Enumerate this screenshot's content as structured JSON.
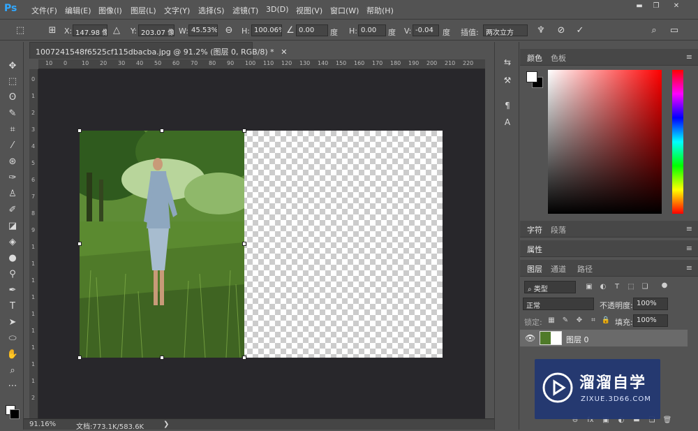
{
  "app": {
    "logo": "Ps"
  },
  "menubar": {
    "items": [
      "文件(F)",
      "编辑(E)",
      "图像(I)",
      "图层(L)",
      "文字(Y)",
      "选择(S)",
      "滤镜(T)",
      "3D(D)",
      "视图(V)",
      "窗口(W)",
      "帮助(H)"
    ]
  },
  "window_controls": {
    "minimize": "▬",
    "restore": "❐",
    "close": "✕"
  },
  "options_bar": {
    "x_label": "X:",
    "x_value": "147.98 像素",
    "y_label": "Y:",
    "y_value": "203.07 像素",
    "w_label": "W:",
    "w_value": "45.53%",
    "h_label": "H:",
    "h_value": "100.06%",
    "angle_value": "0.00",
    "angle_unit": "度",
    "hskew_label": "H:",
    "hskew_value": "0.00",
    "hskew_unit": "度",
    "vskew_label": "V:",
    "vskew_value": "-0.04",
    "vskew_unit": "度",
    "interp_label": "插值:",
    "interp_value": "两次立方"
  },
  "document": {
    "tab_title": "1007241548f6525cf115dbacba.jpg @ 91.2% (图层 0, RGB/8) *",
    "tab_close": "✕"
  },
  "ruler_labels": [
    "10",
    "0",
    "10",
    "20",
    "30",
    "40",
    "50",
    "60",
    "70",
    "80",
    "90",
    "100",
    "110",
    "120",
    "130",
    "140",
    "150",
    "160",
    "170",
    "180",
    "190",
    "200",
    "210",
    "220"
  ],
  "ruler_v_labels": [
    "0",
    "1",
    "2",
    "3",
    "4",
    "5",
    "6",
    "7",
    "8",
    "9",
    "1",
    "1",
    "1",
    "1",
    "1",
    "1",
    "1",
    "1",
    "1",
    "2"
  ],
  "status": {
    "zoom": "91.16%",
    "doc_label": "文档:773.1K/583.6K",
    "arrow": "❯"
  },
  "color_panel": {
    "tab_color": "颜色",
    "tab_swatches": "色板"
  },
  "char_panel": {
    "tab_char": "字符",
    "tab_para": "段落"
  },
  "props_panel": {
    "tab_props": "属性"
  },
  "layers_panel": {
    "tab_layers": "图层",
    "tab_channels": "通道",
    "tab_paths": "路径",
    "filter_kind": "类型",
    "blend_mode": "正常",
    "opacity_label": "不透明度:",
    "opacity_value": "100%",
    "lock_label": "锁定:",
    "fill_label": "填充:",
    "fill_value": "100%",
    "layer_name": "图层 0"
  },
  "watermark": {
    "brand": "溜溜自学",
    "url": "ZIXUE.3D66.COM"
  },
  "colors": {
    "accent": "#31a8ff",
    "watermark_bg": "#22376f"
  }
}
